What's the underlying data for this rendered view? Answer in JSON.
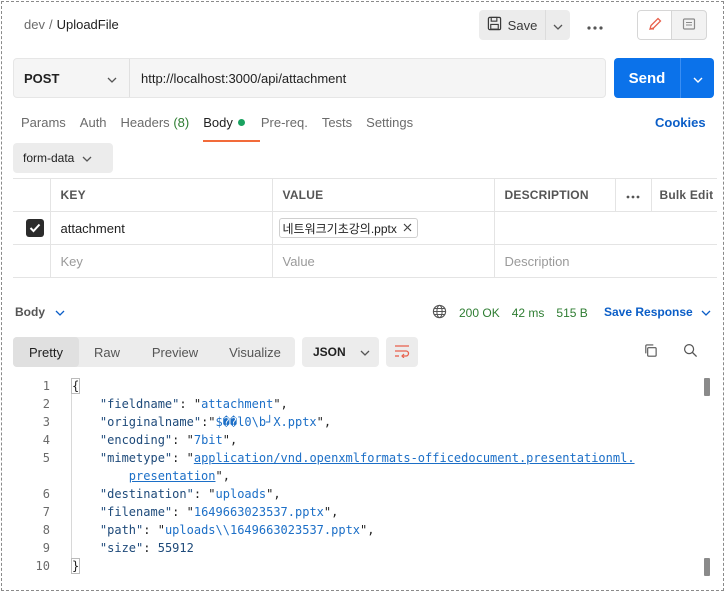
{
  "breadcrumb": {
    "workspace": "dev",
    "separator": "/",
    "request": "UploadFile"
  },
  "header": {
    "save_label": "Save"
  },
  "request": {
    "method": "POST",
    "url": "http://localhost:3000/api/attachment",
    "send_label": "Send"
  },
  "tabs": [
    {
      "label": "Params"
    },
    {
      "label": "Auth"
    },
    {
      "label": "Headers",
      "count": "(8)"
    },
    {
      "label": "Body"
    },
    {
      "label": "Pre-req."
    },
    {
      "label": "Tests"
    },
    {
      "label": "Settings"
    }
  ],
  "cookies_label": "Cookies",
  "body_type": "form-data",
  "params_table": {
    "headers": [
      "KEY",
      "VALUE",
      "DESCRIPTION"
    ],
    "bulk_edit": "Bulk Edit",
    "rows": [
      {
        "checked": true,
        "key": "attachment",
        "value": "네트워크기초강의.pptx",
        "description": ""
      }
    ],
    "placeholders": {
      "key": "Key",
      "value": "Value",
      "description": "Description"
    }
  },
  "response": {
    "section_label": "Body",
    "status": "200 OK",
    "time": "42 ms",
    "size": "515 B",
    "save_response_label": "Save Response",
    "view_tabs": [
      "Pretty",
      "Raw",
      "Preview",
      "Visualize"
    ],
    "format": "JSON",
    "line_numbers": [
      "1",
      "2",
      "3",
      "4",
      "5",
      "",
      "6",
      "7",
      "8",
      "9",
      "10"
    ],
    "json": {
      "fieldname": "attachment",
      "originalname": "$��l0\\b┘X.pptx",
      "encoding": "7bit",
      "mimetype_part1": "application/vnd.openxmlformats-officedocument.presentationml.",
      "mimetype_part2": "presentation",
      "destination": "uploads",
      "filename": "1649663023537.pptx",
      "path": "uploads\\\\1649663023537.pptx",
      "size": "55912"
    }
  }
}
